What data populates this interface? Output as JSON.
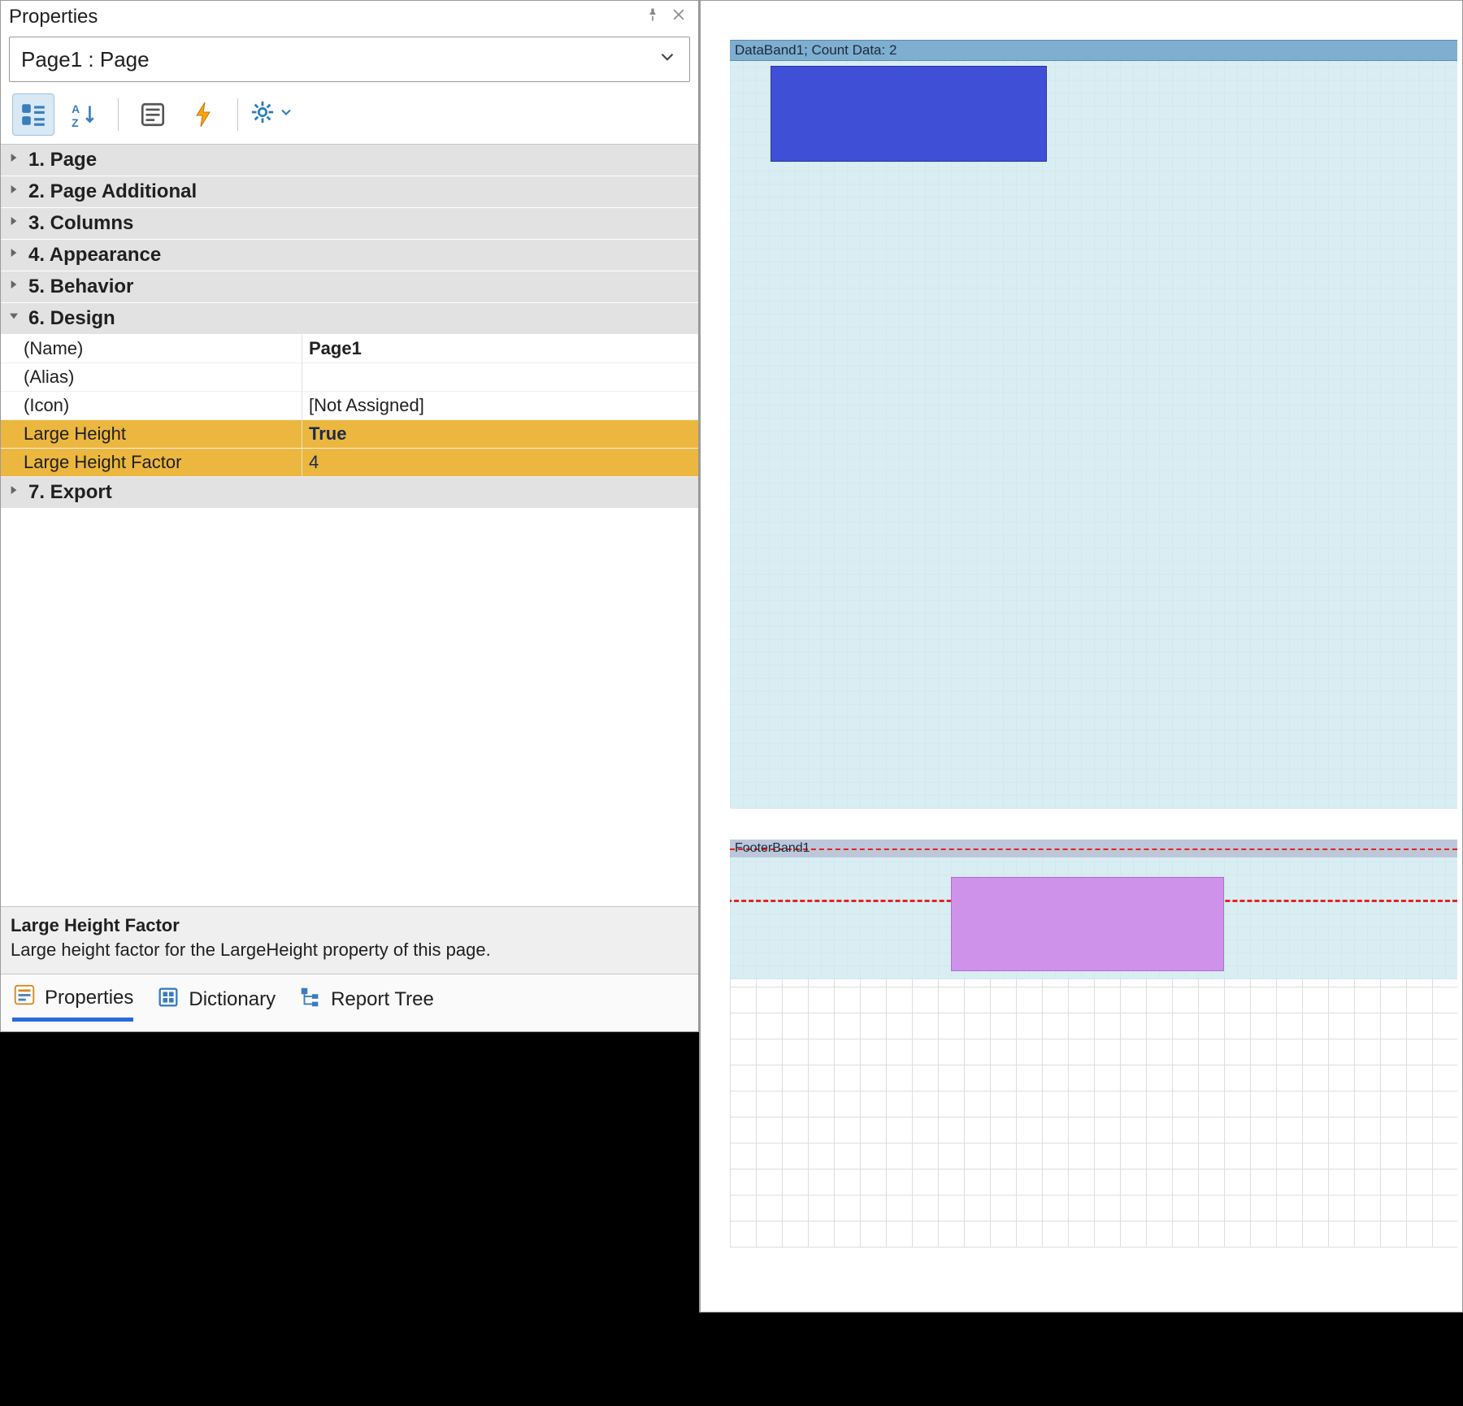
{
  "panel": {
    "title": "Properties",
    "object_selector": "Page1 : Page"
  },
  "groups": [
    {
      "label": "1. Page",
      "expanded": false
    },
    {
      "label": "2. Page  Additional",
      "expanded": false
    },
    {
      "label": "3. Columns",
      "expanded": false
    },
    {
      "label": "4. Appearance",
      "expanded": false
    },
    {
      "label": "5. Behavior",
      "expanded": false
    },
    {
      "label": "6. Design",
      "expanded": true
    },
    {
      "label": "7. Export",
      "expanded": false
    }
  ],
  "design_props": [
    {
      "name": "(Name)",
      "value": "Page1",
      "bold": true,
      "hl": false
    },
    {
      "name": "(Alias)",
      "value": "",
      "bold": false,
      "hl": false
    },
    {
      "name": "(Icon)",
      "value": "[Not Assigned]",
      "bold": false,
      "hl": false
    },
    {
      "name": "Large Height",
      "value": "True",
      "bold": true,
      "hl": true
    },
    {
      "name": "Large Height Factor",
      "value": "4",
      "bold": false,
      "hl": true
    }
  ],
  "hint": {
    "title": "Large Height Factor",
    "text": "Large height factor for the LargeHeight property of this page."
  },
  "tabs": {
    "properties": "Properties",
    "dictionary": "Dictionary",
    "report_tree": "Report Tree"
  },
  "design_surface": {
    "databand_label": "DataBand1; Count Data: 2",
    "footerband_label": "FooterBand1"
  }
}
